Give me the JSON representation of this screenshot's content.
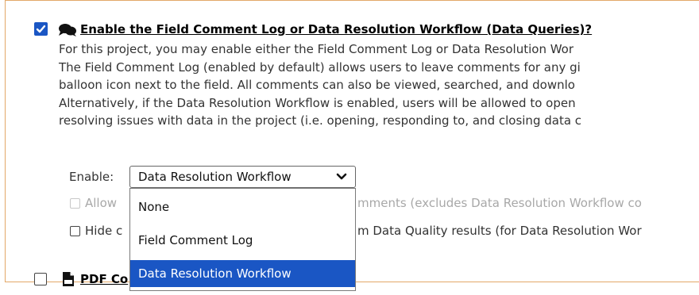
{
  "section1": {
    "checked": true,
    "title": "Enable the Field Comment Log or Data Resolution Workflow (Data Queries)?",
    "paragraph_lines": [
      "For this project, you may enable either the Field Comment Log or Data Resolution Wor",
      "The Field Comment Log (enabled by default) allows users to leave comments for any gi",
      "balloon icon next to the field. All comments can also be viewed, searched, and downlo",
      "Alternatively, if the Data Resolution Workflow is enabled, users will be allowed to open",
      "resolving issues with data in the project (i.e. opening, responding to, and closing data c"
    ],
    "enable_label": "Enable:",
    "select_value": "Data Resolution Workflow",
    "dropdown_options": [
      "None",
      "Field Comment Log",
      "Data Resolution Workflow"
    ],
    "selected_option_index": 2,
    "option_allow_prefix": "Allow",
    "option_allow_suffix": "mments (excludes Data Resolution Workflow co",
    "option_hide_prefix": "Hide c",
    "option_hide_suffix": "m Data Quality results (for Data Resolution Wor"
  },
  "section2": {
    "checked": false,
    "title": "PDF Co"
  },
  "colors": {
    "accent": "#1a56c4",
    "frame_border": "#e3a868",
    "disabled_text": "#a8a8a8"
  }
}
